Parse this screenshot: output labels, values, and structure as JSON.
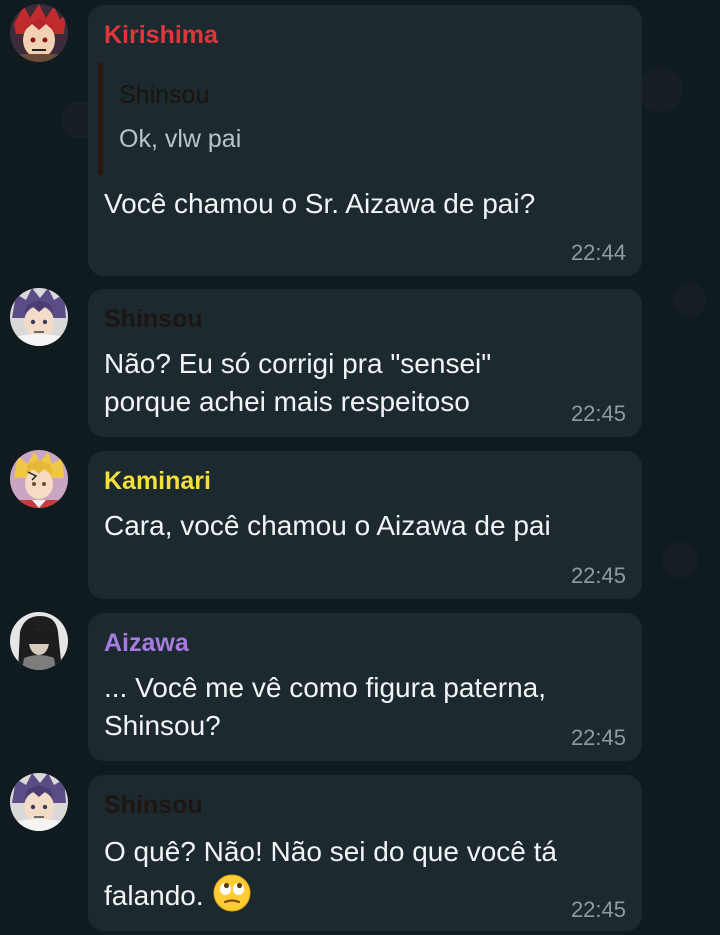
{
  "messages": [
    {
      "sender": "Kirishima",
      "sender_color": "#e0363b",
      "reply": {
        "sender": "Shinsou",
        "text": "Ok, vlw pai"
      },
      "lines": [
        "Você chamou o Sr. Aizawa de pai?"
      ],
      "time": "22:44",
      "avatar_icon": "kirishima-avatar"
    },
    {
      "sender": "Shinsou",
      "sender_color": "#1c1512",
      "lines": [
        "Não? Eu só corrigi pra \"sensei\"",
        "porque achei mais respeitoso"
      ],
      "time": "22:45",
      "avatar_icon": "shinsou-avatar"
    },
    {
      "sender": "Kaminari",
      "sender_color": "#f3df3d",
      "lines": [
        "Cara, você chamou o Aizawa de pai"
      ],
      "time": "22:45",
      "avatar_icon": "kaminari-avatar"
    },
    {
      "sender": "Aizawa",
      "sender_color": "#a77be0",
      "lines": [
        "... Você me vê como figura paterna,",
        "Shinsou?"
      ],
      "time": "22:45",
      "avatar_icon": "aizawa-avatar"
    },
    {
      "sender": "Shinsou",
      "sender_color": "#1c1512",
      "lines": [
        "O quê? Não! Não sei do que você tá",
        "falando."
      ],
      "emoji": "eye-roll-emoji",
      "time": "22:45",
      "avatar_icon": "shinsou-avatar"
    }
  ]
}
